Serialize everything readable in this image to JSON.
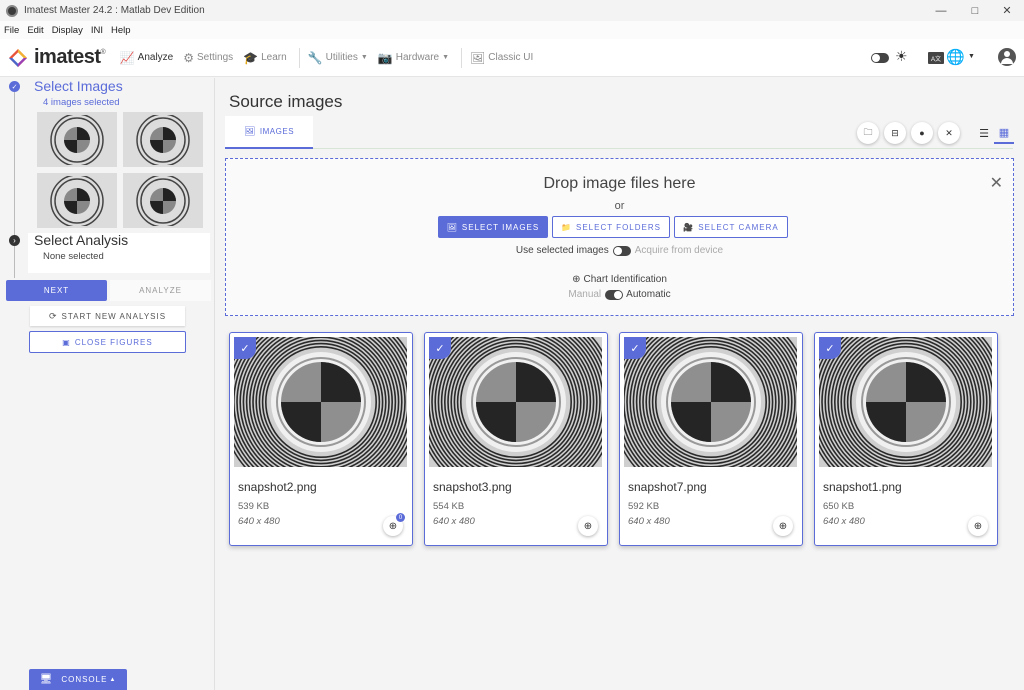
{
  "window": {
    "title": "Imatest Master 24.2 : Matlab Dev Edition"
  },
  "menu": [
    "File",
    "Edit",
    "Display",
    "INI",
    "Help"
  ],
  "toolbar": {
    "logo": "imatest",
    "logo_mark": "®",
    "analyze": "Analyze",
    "settings": "Settings",
    "learn": "Learn",
    "utilities": "Utilities",
    "hardware": "Hardware",
    "classic_ui": "Classic UI",
    "lang_label": "A文"
  },
  "sidebar": {
    "step1_title": "Select Images",
    "step1_sub": "4 images selected",
    "step2_title": "Select Analysis",
    "step2_sub": "None selected",
    "next_label": "NEXT",
    "analyze_label": "ANALYZE",
    "start_new_label": "START NEW ANALYSIS",
    "close_figures_label": "CLOSE FIGURES",
    "console_label": "CONSOLE"
  },
  "main": {
    "title": "Source images",
    "tab_label": "IMAGES",
    "drop_title": "Drop image files here",
    "drop_or": "or",
    "select_images": "SELECT IMAGES",
    "select_folders": "SELECT FOLDERS",
    "select_camera": "SELECT CAMERA",
    "use_selected": "Use selected images",
    "acquire": "Acquire from device",
    "chart_id": "Chart Identification",
    "manual": "Manual",
    "automatic": "Automatic"
  },
  "images": [
    {
      "name": "snapshot2.png",
      "size": "539 KB",
      "dims": "640 x 480",
      "badge": "0"
    },
    {
      "name": "snapshot3.png",
      "size": "554 KB",
      "dims": "640 x 480",
      "badge": ""
    },
    {
      "name": "snapshot7.png",
      "size": "592 KB",
      "dims": "640 x 480",
      "badge": ""
    },
    {
      "name": "snapshot1.png",
      "size": "650 KB",
      "dims": "640 x 480",
      "badge": ""
    }
  ],
  "colors": {
    "accent": "#5b6cd9"
  }
}
